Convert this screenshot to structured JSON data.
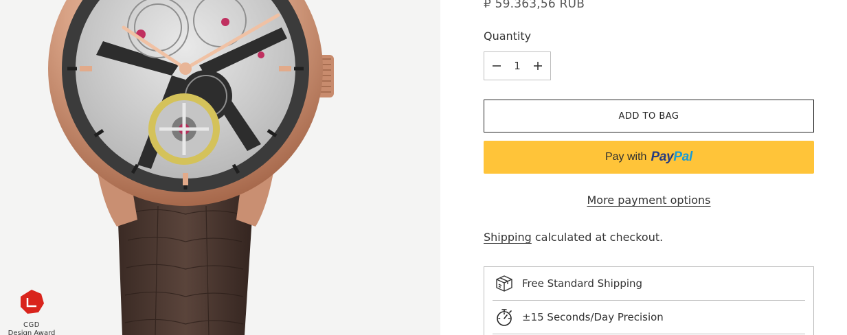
{
  "product": {
    "price": "₽ 59.363,56 RUB",
    "quantity_label": "Quantity",
    "quantity_value": "1"
  },
  "actions": {
    "add_to_bag_label": "ADD TO BAG",
    "paypal_prefix": "Pay with",
    "paypal_brand_pay": "Pay",
    "paypal_brand_pal": "Pal",
    "more_payment_options": "More payment options"
  },
  "shipping": {
    "link_text": "Shipping",
    "suffix": " calculated at checkout."
  },
  "features": [
    {
      "icon": "box-icon",
      "label": "Free Standard Shipping"
    },
    {
      "icon": "stopwatch-icon",
      "label": "±15 Seconds/Day Precision"
    }
  ],
  "award": {
    "title": "CGD",
    "subtitle": "Design Award"
  },
  "colors": {
    "paypal_yellow": "#ffc439",
    "paypal_dark_blue": "#253b80",
    "paypal_light_blue": "#179bd7",
    "award_red": "#d9241c",
    "rose_gold": "#d8a285"
  },
  "icons": [
    "minus-icon",
    "plus-icon",
    "box-icon",
    "stopwatch-icon",
    "award-logo"
  ]
}
